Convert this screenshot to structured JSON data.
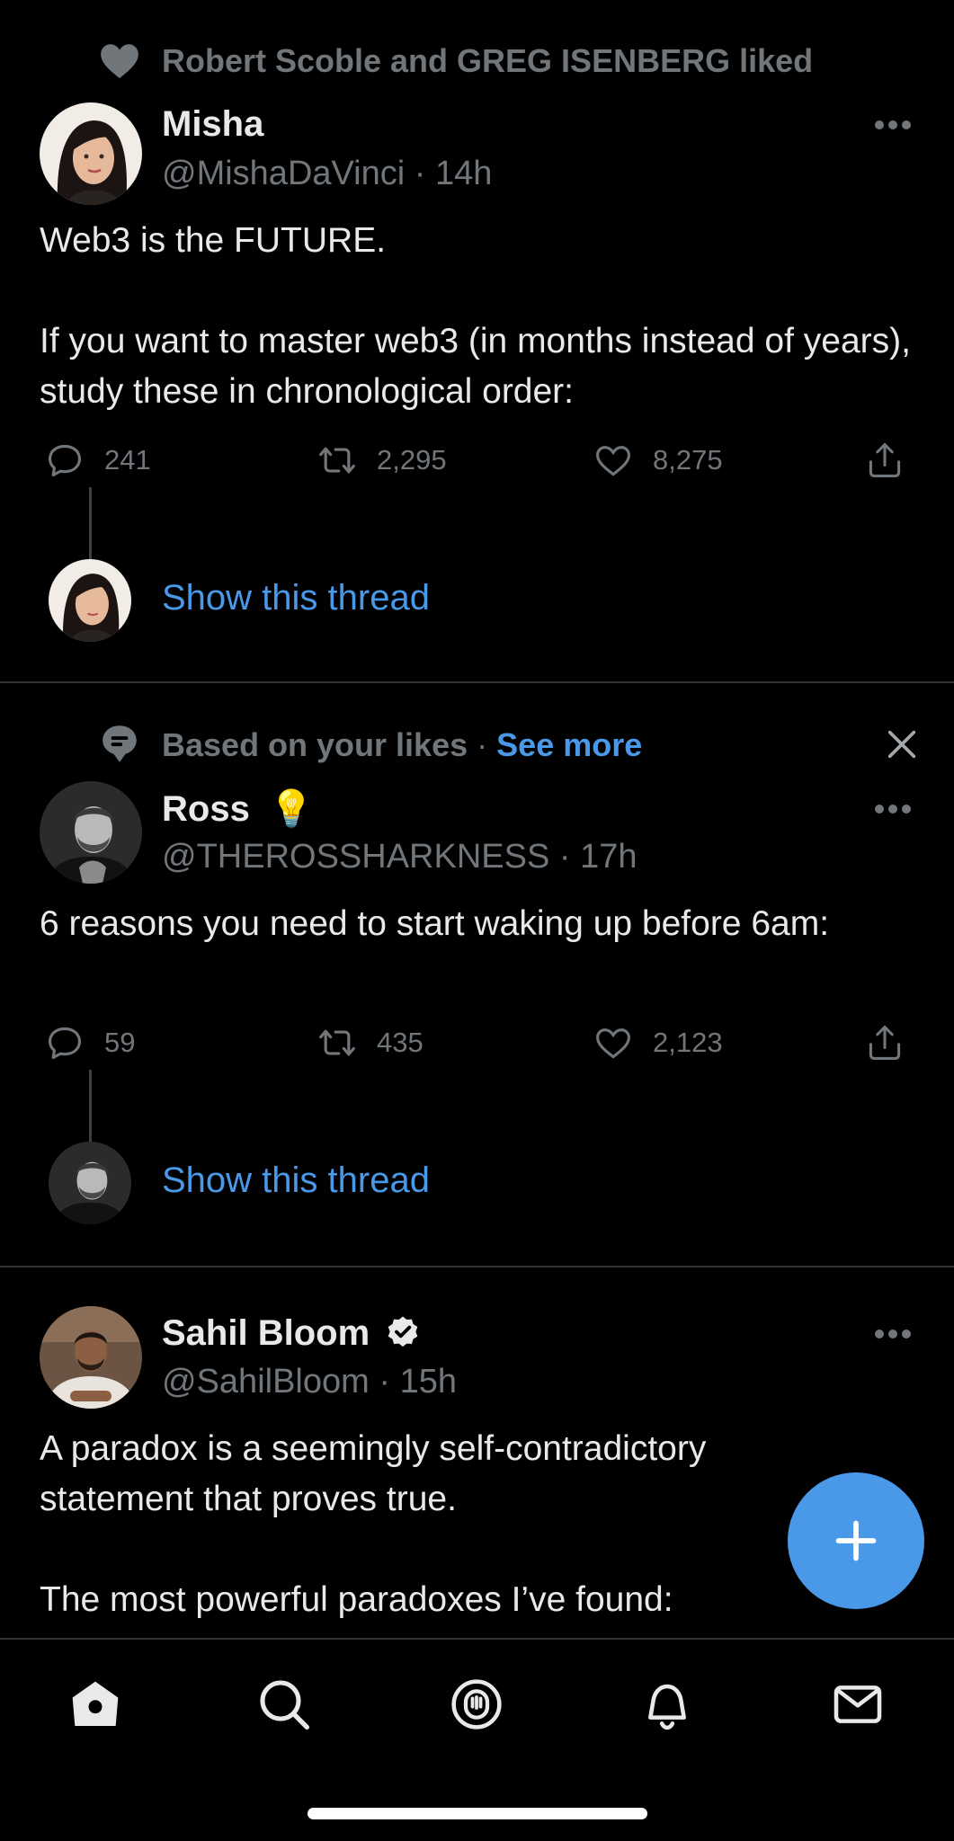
{
  "tweets": [
    {
      "context": "Robert Scoble and GREG ISENBERG liked",
      "name": "Misha",
      "handle": "@MishaDaVinci",
      "time": "· 14h",
      "text": "Web3 is the FUTURE.\n\nIf you want to master web3 (in months instead of years), study these in chronological order:",
      "replies": "241",
      "retweets": "2,295",
      "likes": "8,275",
      "show_thread": "Show this thread"
    },
    {
      "context": "Based on your likes",
      "context_sep": "·",
      "context_link": "See more",
      "name": "Ross",
      "name_emoji": "💡",
      "handle": "@THEROSSHARKNESS",
      "time": "· 17h",
      "text": "6 reasons you need to start waking up before 6am:",
      "replies": "59",
      "retweets": "435",
      "likes": "2,123",
      "show_thread": "Show this thread"
    },
    {
      "name": "Sahil Bloom",
      "verified": true,
      "handle": "@SahilBloom",
      "time": "· 15h",
      "text": "A paradox is a seemingly self-contradictory statement that proves true.\n\nThe most powerful paradoxes I’ve found:"
    }
  ],
  "nav": [
    "home-icon",
    "search-icon",
    "spaces-icon",
    "notifications-icon",
    "messages-icon"
  ],
  "colors": {
    "accent": "#4a99e9",
    "muted": "#71767b",
    "text": "#e7e9ea",
    "background": "#000000"
  }
}
